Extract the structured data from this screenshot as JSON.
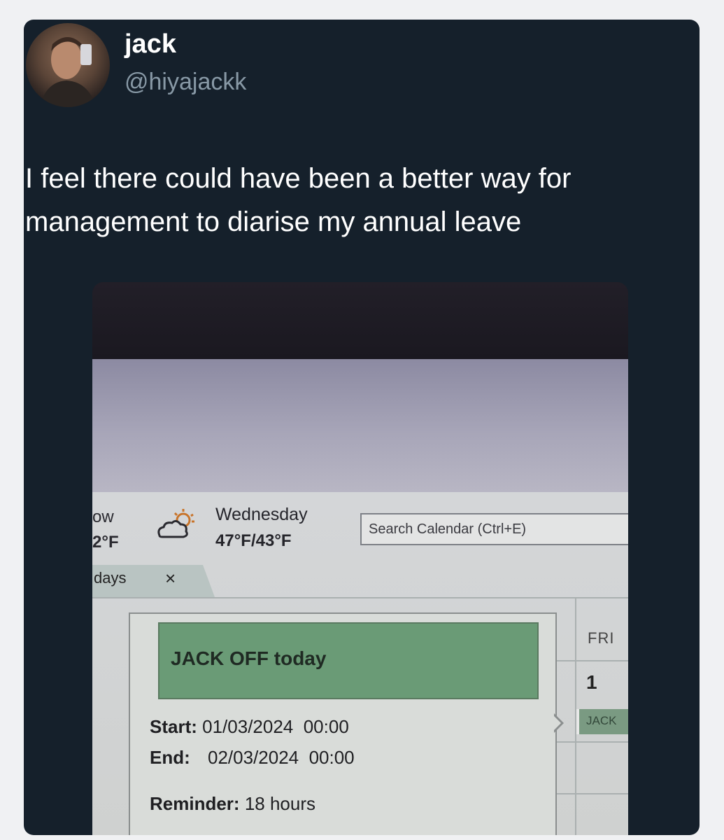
{
  "author": {
    "name": "jack",
    "handle": "@hiyajackk"
  },
  "tweet": {
    "text": "I feel there could have been a better way for management to diarise my annual leave"
  },
  "photo": {
    "weather_left": {
      "label": "ow",
      "temp": "2°F"
    },
    "weather": {
      "day": "Wednesday",
      "temp": "47°F/43°F",
      "icon": "partly-cloudy-icon"
    },
    "search": {
      "placeholder": "Search Calendar (Ctrl+E)"
    },
    "tab": {
      "label": "days",
      "close": "×"
    },
    "calendar": {
      "day_header": "FRI",
      "day_number": "1",
      "event_chip": "JACK"
    },
    "popup": {
      "title": "JACK OFF today",
      "start_label": "Start:",
      "start_value": "01/03/2024  00:00",
      "end_label": "End:",
      "end_value": "02/03/2024  00:00",
      "reminder_label": "Reminder:",
      "reminder_value": "18 hours"
    }
  },
  "colors": {
    "card_bg": "#15202b",
    "handle": "#8899a6",
    "event_green": "#6a9b76"
  }
}
